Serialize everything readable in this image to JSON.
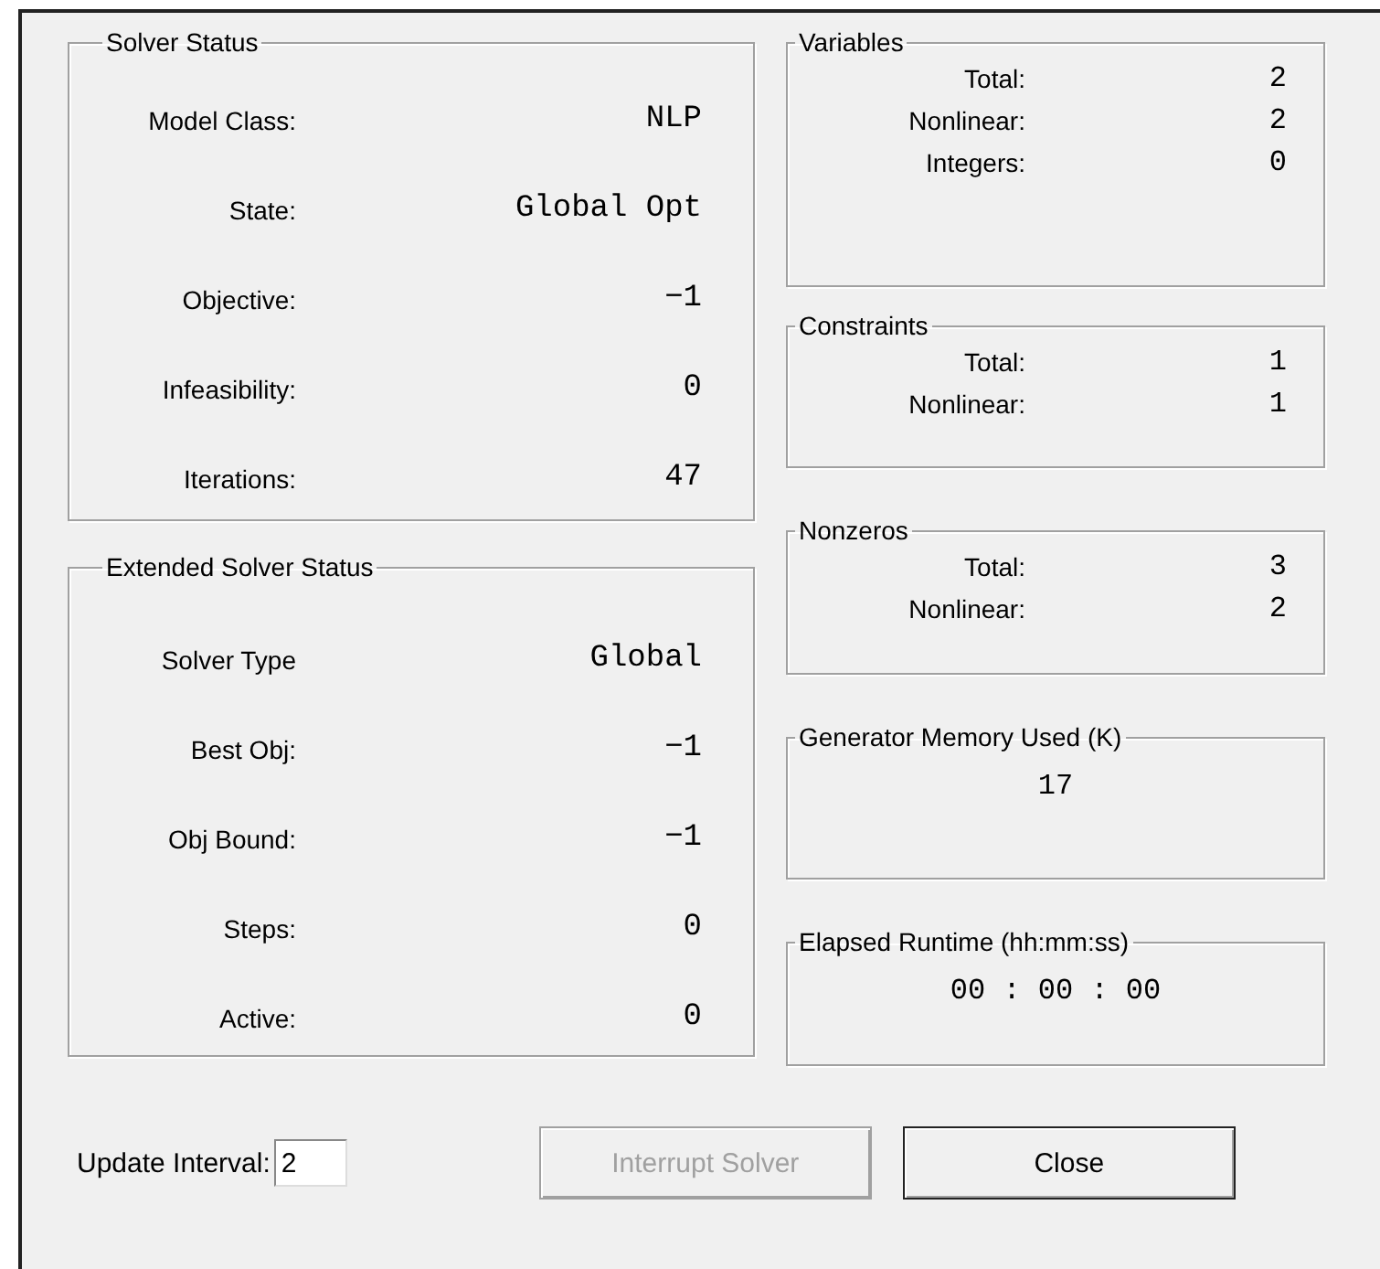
{
  "solver_status": {
    "title": "Solver Status",
    "rows": [
      {
        "label": "Model Class:",
        "value": "NLP"
      },
      {
        "label": "State:",
        "value": "Global Opt"
      },
      {
        "label": "Objective:",
        "value": "−1"
      },
      {
        "label": "Infeasibility:",
        "value": "0"
      },
      {
        "label": "Iterations:",
        "value": "47"
      }
    ]
  },
  "extended_solver_status": {
    "title": "Extended Solver Status",
    "rows": [
      {
        "label": "Solver Type",
        "value": "Global"
      },
      {
        "label": "Best Obj:",
        "value": "−1"
      },
      {
        "label": "Obj Bound:",
        "value": "−1"
      },
      {
        "label": "Steps:",
        "value": "0"
      },
      {
        "label": "Active:",
        "value": "0"
      }
    ]
  },
  "variables": {
    "title": "Variables",
    "rows": [
      {
        "label": "Total:",
        "value": "2"
      },
      {
        "label": "Nonlinear:",
        "value": "2"
      },
      {
        "label": "Integers:",
        "value": "0"
      }
    ]
  },
  "constraints": {
    "title": "Constraints",
    "rows": [
      {
        "label": "Total:",
        "value": "1"
      },
      {
        "label": "Nonlinear:",
        "value": "1"
      }
    ]
  },
  "nonzeros": {
    "title": "Nonzeros",
    "rows": [
      {
        "label": "Total:",
        "value": "3"
      },
      {
        "label": "Nonlinear:",
        "value": "2"
      }
    ]
  },
  "generator_memory": {
    "title": "Generator Memory Used (K)",
    "value": "17"
  },
  "elapsed_runtime": {
    "title": "Elapsed Runtime (hh:mm:ss)",
    "value": "00 : 00 : 00"
  },
  "update_interval": {
    "label": "Update Interval:",
    "value": "2"
  },
  "buttons": [
    {
      "label": "Interrupt Solver",
      "disabled": true
    },
    {
      "label": "Close",
      "disabled": false
    }
  ]
}
